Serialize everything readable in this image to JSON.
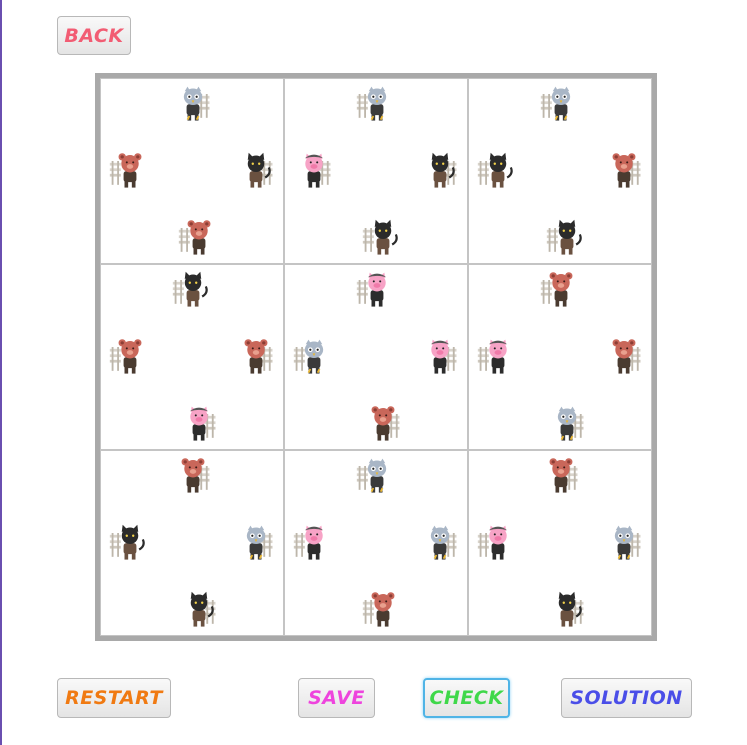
{
  "buttons": {
    "back": {
      "label": "BACK",
      "color": "#f25c73"
    },
    "restart": {
      "label": "RESTART",
      "color": "#f07a12"
    },
    "save": {
      "label": "SAVE",
      "color": "#ee44dd"
    },
    "check": {
      "label": "CHECK",
      "color": "#3fd84a"
    },
    "solution": {
      "label": "SOLUTION",
      "color": "#4a4ee8"
    }
  },
  "board": {
    "rows": 3,
    "cols": 3,
    "cells": [
      {
        "pieces": [
          {
            "animal": "owl",
            "bench": "right",
            "pos": "top"
          },
          {
            "animal": "bear",
            "bench": "left",
            "pos": "left"
          },
          {
            "animal": "cat",
            "bench": "right",
            "pos": "right"
          },
          {
            "animal": "bear",
            "bench": "left",
            "pos": "bottom"
          }
        ]
      },
      {
        "pieces": [
          {
            "animal": "owl",
            "bench": "left",
            "pos": "top"
          },
          {
            "animal": "pig",
            "bench": "right",
            "pos": "left"
          },
          {
            "animal": "cat",
            "bench": "right",
            "pos": "right"
          },
          {
            "animal": "cat",
            "bench": "left",
            "pos": "bottom"
          }
        ]
      },
      {
        "pieces": [
          {
            "animal": "owl",
            "bench": "left",
            "pos": "top"
          },
          {
            "animal": "cat",
            "bench": "left",
            "pos": "left"
          },
          {
            "animal": "bear",
            "bench": "right",
            "pos": "right"
          },
          {
            "animal": "cat",
            "bench": "left",
            "pos": "bottom"
          }
        ]
      },
      {
        "pieces": [
          {
            "animal": "cat",
            "bench": "left",
            "pos": "top"
          },
          {
            "animal": "bear",
            "bench": "left",
            "pos": "left"
          },
          {
            "animal": "bear",
            "bench": "right",
            "pos": "right"
          },
          {
            "animal": "pig",
            "bench": "right",
            "pos": "bottom"
          }
        ]
      },
      {
        "pieces": [
          {
            "animal": "pig",
            "bench": "left",
            "pos": "top"
          },
          {
            "animal": "owl",
            "bench": "left",
            "pos": "left"
          },
          {
            "animal": "pig",
            "bench": "right",
            "pos": "right"
          },
          {
            "animal": "bear",
            "bench": "right",
            "pos": "bottom"
          }
        ]
      },
      {
        "pieces": [
          {
            "animal": "bear",
            "bench": "left",
            "pos": "top"
          },
          {
            "animal": "pig",
            "bench": "left",
            "pos": "left"
          },
          {
            "animal": "bear",
            "bench": "right",
            "pos": "right"
          },
          {
            "animal": "owl",
            "bench": "right",
            "pos": "bottom"
          }
        ]
      },
      {
        "pieces": [
          {
            "animal": "bear",
            "bench": "right",
            "pos": "top"
          },
          {
            "animal": "cat",
            "bench": "left",
            "pos": "left"
          },
          {
            "animal": "owl",
            "bench": "right",
            "pos": "right"
          },
          {
            "animal": "cat",
            "bench": "right",
            "pos": "bottom"
          }
        ]
      },
      {
        "pieces": [
          {
            "animal": "owl",
            "bench": "left",
            "pos": "top"
          },
          {
            "animal": "pig",
            "bench": "left",
            "pos": "left"
          },
          {
            "animal": "owl",
            "bench": "right",
            "pos": "right"
          },
          {
            "animal": "bear",
            "bench": "left",
            "pos": "bottom"
          }
        ]
      },
      {
        "pieces": [
          {
            "animal": "bear",
            "bench": "right",
            "pos": "top"
          },
          {
            "animal": "pig",
            "bench": "left",
            "pos": "left"
          },
          {
            "animal": "owl",
            "bench": "right",
            "pos": "right"
          },
          {
            "animal": "cat",
            "bench": "right",
            "pos": "bottom"
          }
        ]
      }
    ]
  },
  "animal_colors": {
    "owl": "#a9b6c6",
    "cat": "#2b2b2b",
    "bear": "#c9675a",
    "pig": "#f7a3c6"
  }
}
